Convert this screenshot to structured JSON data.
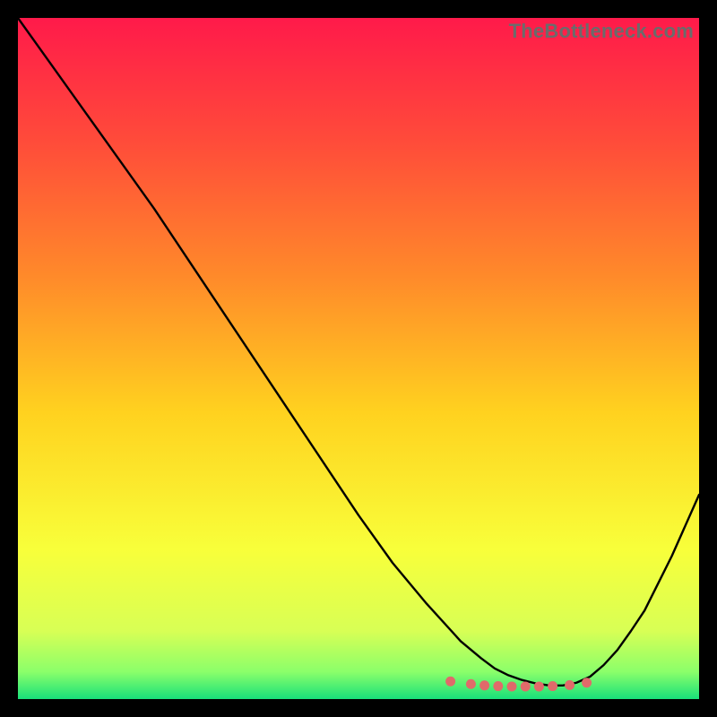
{
  "watermark": "TheBottleneck.com",
  "chart_data": {
    "type": "line",
    "title": "",
    "xlabel": "",
    "ylabel": "",
    "xlim": [
      0,
      100
    ],
    "ylim": [
      0,
      100
    ],
    "grid": false,
    "background_gradient": {
      "type": "vertical",
      "stops": [
        {
          "pos": 0.0,
          "color": "#ff1a4a"
        },
        {
          "pos": 0.18,
          "color": "#ff4b3a"
        },
        {
          "pos": 0.38,
          "color": "#ff8a2a"
        },
        {
          "pos": 0.58,
          "color": "#ffd21f"
        },
        {
          "pos": 0.78,
          "color": "#f8ff3a"
        },
        {
          "pos": 0.9,
          "color": "#d8ff55"
        },
        {
          "pos": 0.96,
          "color": "#8bff6a"
        },
        {
          "pos": 1.0,
          "color": "#18e07a"
        }
      ]
    },
    "series": [
      {
        "name": "bottleneck-curve",
        "color": "#000000",
        "x": [
          0,
          5,
          10,
          15,
          20,
          25,
          30,
          35,
          40,
          45,
          50,
          55,
          60,
          65,
          68,
          70,
          72,
          74,
          76,
          78,
          80,
          82,
          84,
          86,
          88,
          90,
          92,
          94,
          96,
          98,
          100
        ],
        "y": [
          100,
          93,
          86,
          79,
          72,
          64.5,
          57,
          49.5,
          42,
          34.5,
          27,
          20,
          14,
          8.5,
          6.0,
          4.5,
          3.5,
          2.8,
          2.3,
          2.0,
          2.0,
          2.4,
          3.3,
          5.0,
          7.2,
          10,
          13,
          17,
          21,
          25.5,
          30
        ]
      }
    ],
    "markers": {
      "name": "typical-range-dots",
      "color": "#e06a6a",
      "x": [
        63.5,
        66.5,
        68.5,
        70.5,
        72.5,
        74.5,
        76.5,
        78.5,
        81.0,
        83.5
      ],
      "y": [
        2.6,
        2.2,
        2.0,
        1.9,
        1.85,
        1.85,
        1.85,
        1.9,
        2.05,
        2.4
      ]
    }
  }
}
